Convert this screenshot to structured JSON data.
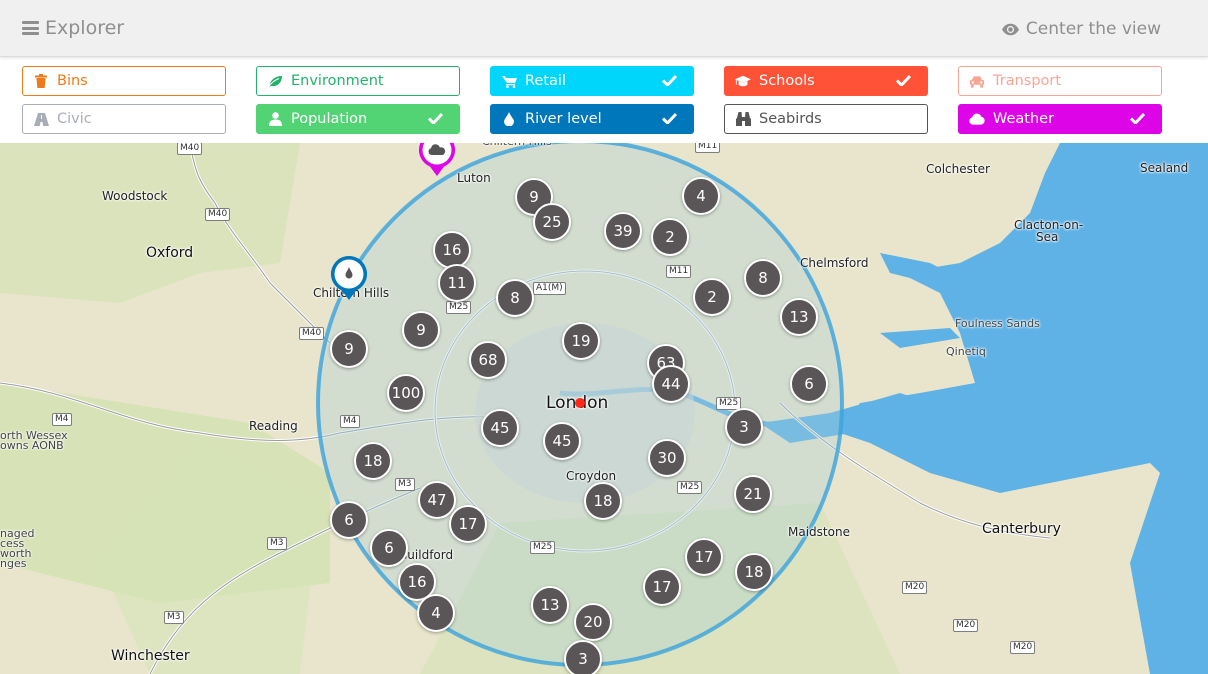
{
  "header": {
    "title": "Explorer",
    "center_view_label": "Center the view"
  },
  "filters": [
    {
      "label": "Bins",
      "icon": "trash-icon",
      "color": "#f07a1a",
      "active": false
    },
    {
      "label": "Environment",
      "icon": "leaf-icon",
      "color": "#21b36a",
      "active": false
    },
    {
      "label": "Retail",
      "icon": "shopping-cart-icon",
      "color": "#00d5fc",
      "active": true
    },
    {
      "label": "Schools",
      "icon": "graduation-cap-icon",
      "color": "#ff5237",
      "active": true
    },
    {
      "label": "Transport",
      "icon": "car-icon",
      "color": "#f9a596",
      "active": false
    },
    {
      "label": "Civic",
      "icon": "road-icon",
      "color": "#a9aeb6",
      "active": false
    },
    {
      "label": "Population",
      "icon": "user-icon",
      "color": "#52d374",
      "active": true
    },
    {
      "label": "River level",
      "icon": "water-drop-icon",
      "color": "#0077bb",
      "active": true
    },
    {
      "label": "Seabirds",
      "icon": "binoculars-icon",
      "color": "#555555",
      "active": false
    },
    {
      "label": "Weather",
      "icon": "cloud-icon",
      "color": "#dd05e8",
      "active": true
    }
  ],
  "map": {
    "center_label": "London",
    "radius_color": "#3aa3dc",
    "places": [
      {
        "name": "Woodstock",
        "kind": "town"
      },
      {
        "name": "Oxford",
        "kind": "city"
      },
      {
        "name": "Chiltern Hills",
        "kind": "town"
      },
      {
        "name": "Chiltern Hills",
        "kind": "town"
      },
      {
        "name": "Luton",
        "kind": "town"
      },
      {
        "name": "Reading",
        "kind": "town"
      },
      {
        "name": "orth Wessex",
        "kind": "small"
      },
      {
        "name": "owns AONB",
        "kind": "small"
      },
      {
        "name": "naged",
        "kind": "small"
      },
      {
        "name": "cess",
        "kind": "small"
      },
      {
        "name": "worth",
        "kind": "small"
      },
      {
        "name": "nges",
        "kind": "small"
      },
      {
        "name": "Winchester",
        "kind": "city"
      },
      {
        "name": "Guildford",
        "kind": "town"
      },
      {
        "name": "Croydon",
        "kind": "town"
      },
      {
        "name": "Colchester",
        "kind": "town"
      },
      {
        "name": "Sealand",
        "kind": "town"
      },
      {
        "name": "Clacton-on-",
        "kind": "town"
      },
      {
        "name": "Sea",
        "kind": "town"
      },
      {
        "name": "Chelmsford",
        "kind": "town"
      },
      {
        "name": "Foulness Sands",
        "kind": "small"
      },
      {
        "name": "Qinetiq",
        "kind": "small"
      },
      {
        "name": "Maidstone",
        "kind": "town"
      },
      {
        "name": "Canterbury",
        "kind": "city"
      }
    ],
    "roads": [
      "M40",
      "M40",
      "M40",
      "M4",
      "M4",
      "M3",
      "M3",
      "M3",
      "M25",
      "M25",
      "M25",
      "M25",
      "A1(M)",
      "M11",
      "M11",
      "M20",
      "M20",
      "M20"
    ],
    "clusters": [
      {
        "count": "9"
      },
      {
        "count": "25"
      },
      {
        "count": "39"
      },
      {
        "count": "2"
      },
      {
        "count": "4"
      },
      {
        "count": "16"
      },
      {
        "count": "11"
      },
      {
        "count": "8"
      },
      {
        "count": "2"
      },
      {
        "count": "8"
      },
      {
        "count": "13"
      },
      {
        "count": "9"
      },
      {
        "count": "9"
      },
      {
        "count": "68"
      },
      {
        "count": "19"
      },
      {
        "count": "63"
      },
      {
        "count": "44"
      },
      {
        "count": "6"
      },
      {
        "count": "100"
      },
      {
        "count": "45"
      },
      {
        "count": "45"
      },
      {
        "count": "3"
      },
      {
        "count": "18"
      },
      {
        "count": "30"
      },
      {
        "count": "47"
      },
      {
        "count": "17"
      },
      {
        "count": "18"
      },
      {
        "count": "21"
      },
      {
        "count": "6"
      },
      {
        "count": "6"
      },
      {
        "count": "16"
      },
      {
        "count": "4"
      },
      {
        "count": "17"
      },
      {
        "count": "18"
      },
      {
        "count": "17"
      },
      {
        "count": "13"
      },
      {
        "count": "20"
      },
      {
        "count": "3"
      }
    ],
    "pins": [
      {
        "type": "weather",
        "icon": "cloud-icon",
        "color": "#dd05e8"
      },
      {
        "type": "river-level",
        "icon": "water-drop-icon",
        "color": "#0077bb"
      }
    ]
  }
}
